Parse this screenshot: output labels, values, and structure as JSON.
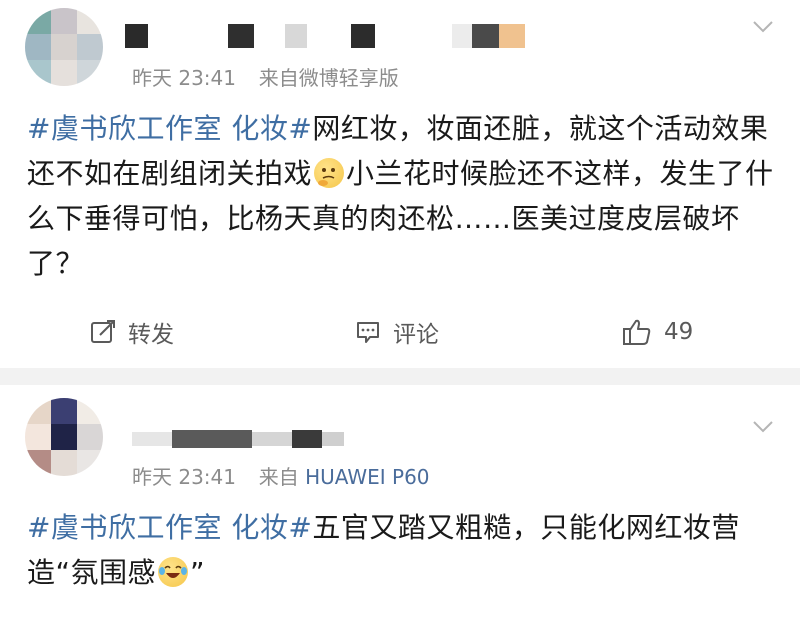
{
  "posts": [
    {
      "time": "昨天 23:41",
      "source": "来自微博轻享版",
      "tag": "#虞书欣工作室 化妆#",
      "text": "网红妆，妆面还脏，就这个活动效果还不如在剧组闭关拍戏",
      "text_after_emoji": "小兰花时候脸还不这样，发生了什么下垂得可怕，比杨天真的肉还松……医美过度皮层破坏了？",
      "emoji": "thinking-face-emoji",
      "actions": {
        "repost": "转发",
        "comment": "评论",
        "likes": "49"
      }
    },
    {
      "time": "昨天 23:41",
      "source_prefix": "来自",
      "source_device": "HUAWEI P60",
      "tag": "#虞书欣工作室 化妆#",
      "text": "五官又踏又粗糙，只能化网红妆营造“氛围感",
      "text_end": "”",
      "emoji": "laughing-tears-emoji"
    }
  ],
  "colors": {
    "tag_blue": "#3f6ea3",
    "meta_gray": "#8c8c8c",
    "separator": "#f2f2f2"
  }
}
